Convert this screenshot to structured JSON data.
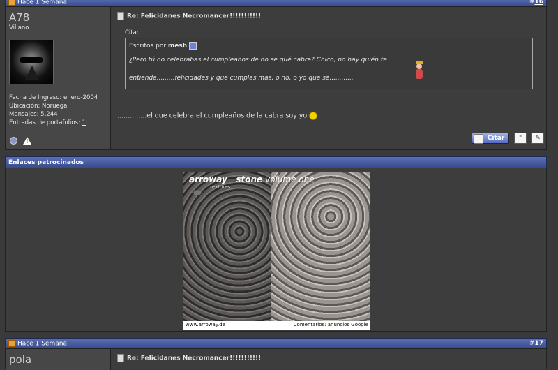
{
  "post1": {
    "header_date": "Hace 1 Semana",
    "post_number": "16",
    "username": "A78",
    "user_title": "Villano",
    "join_date": "Fecha de Ingreso: enero-2004",
    "location": "Ubicación: Noruega",
    "messages": "Mensajes: 5,244",
    "portfolio_label": "Entradas de portafolios: ",
    "portfolio_count": "1",
    "title": "Re: Felicidanes Necromancer!!!!!!!!!!!",
    "quote_label": "Cita:",
    "quote_by_prefix": "Escritos por ",
    "quote_author": "mesh",
    "quote_line1": "¿Pero tú no celebrabas el cumpleaños de no se qué cabra? Chico, no hay quién te",
    "quote_line2": "entienda.........felicidades y que cumplas mas, o no, o yo que sé............",
    "message": "..............el que celebra el cumpleaños de la cabra soy yo",
    "quote_button": "Citar"
  },
  "sponsored": {
    "header": "Enlaces patrocinados",
    "ad_brand": "arroway",
    "ad_brand_sub": "textures",
    "ad_product": "stone",
    "ad_product_rest": " volume one",
    "ad_url": "www.arroway.de",
    "ad_feedback": "Comentarios: anuncios Google"
  },
  "post2": {
    "header_date": "Hace 1 Semana",
    "post_number": "17",
    "username": "pola",
    "title": "Re: Felicidanes Necromancer!!!!!!!!!!!"
  }
}
